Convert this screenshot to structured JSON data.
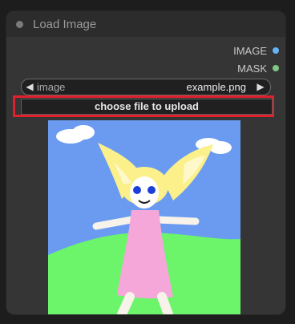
{
  "node": {
    "title": "Load Image"
  },
  "outputs": [
    {
      "label": "IMAGE",
      "color": "#64b5f6"
    },
    {
      "label": "MASK",
      "color": "#81c784"
    }
  ],
  "widget": {
    "label": "image",
    "value": "example.png",
    "left_arrow": "◀",
    "right_arrow": "▶"
  },
  "upload_button": {
    "label": "choose file to upload"
  },
  "preview": {
    "sky_color": "#6b9bf0",
    "grass_color": "#6cf56a",
    "hair_color": "#fbf08a",
    "dress_color": "#f4a7d8"
  }
}
